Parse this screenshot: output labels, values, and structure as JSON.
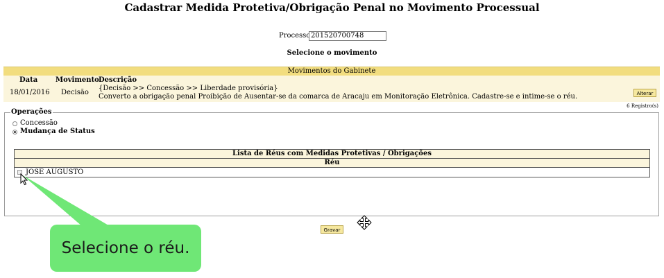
{
  "page": {
    "title": "Cadastrar Medida Protetiva/Obrigação Penal no Movimento Processual"
  },
  "processo": {
    "label": "Processo:",
    "value": "201520700748"
  },
  "select_heading": "Selecione o movimento",
  "movimentos": {
    "header": "Movimentos do Gabinete",
    "columns": [
      "Data",
      "Movimento",
      "Descrição"
    ],
    "rows": [
      {
        "data": "18/01/2016",
        "movimento": "Decisão",
        "descricao_line1": "{Decisão >> Concessão >> Liberdade provisória}",
        "descricao_line2": "Converto a obrigação penal Proibição de Ausentar-se da comarca de Aracaju em Monitoração Eletrônica. Cadastre-se e intime-se o réu.",
        "action_label": "Alterar"
      }
    ],
    "record_count": "6 Registro(s)"
  },
  "operacoes": {
    "legend": "Operações",
    "options": [
      {
        "label": "Concessão",
        "checked": false
      },
      {
        "label": "Mudança de Status",
        "checked": true
      }
    ]
  },
  "reus": {
    "title": "Lista de Réus com Medidas Protetivas / Obrigações",
    "column": "Réu",
    "items": [
      {
        "name": "JOSE AUGUSTO",
        "checked": false
      }
    ]
  },
  "save_label": "Gravar",
  "callout_text": "Selecione o réu.",
  "colors": {
    "header_yellow": "#f2dd7f",
    "row_cream": "#fbf5dc",
    "callout_green": "#6fe776"
  },
  "icons": {
    "move": "move-cursor-icon",
    "pointer": "mouse-pointer-icon"
  }
}
